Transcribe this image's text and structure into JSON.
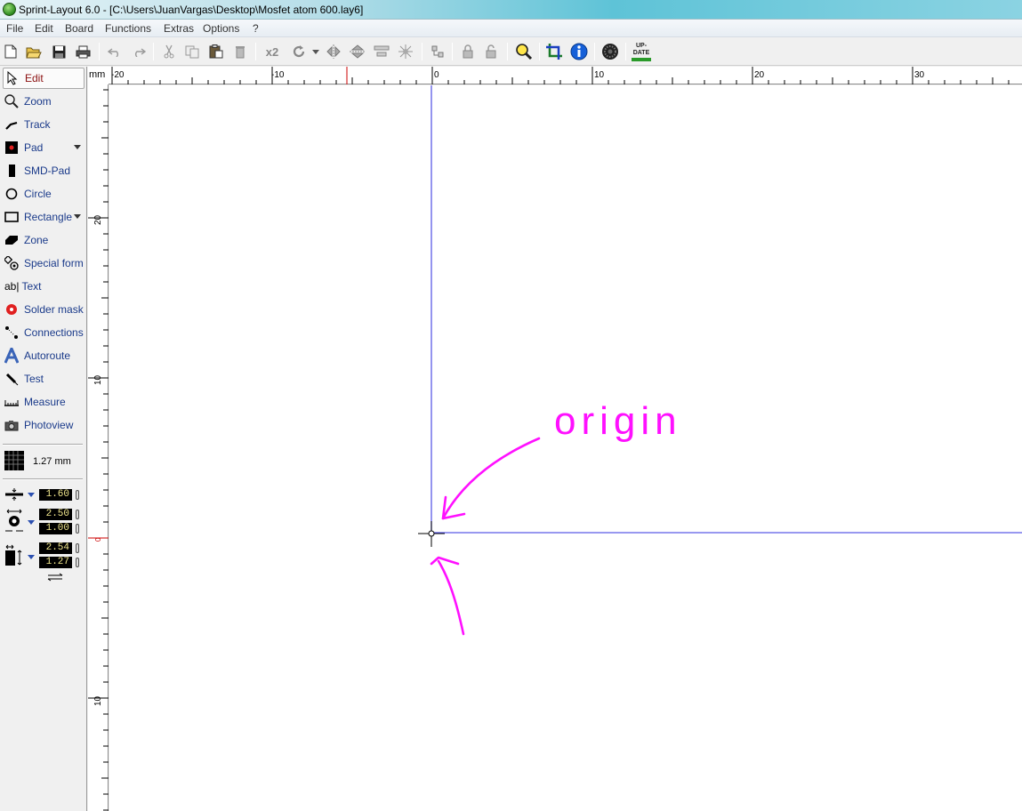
{
  "window": {
    "title": "Sprint-Layout 6.0 - [C:\\Users\\JuanVargas\\Desktop\\Mosfet atom 600.lay6]"
  },
  "menu": [
    "File",
    "Edit",
    "Board",
    "Functions",
    "Extras",
    "Options",
    "?"
  ],
  "toolbar": {
    "icons": [
      "new-file-icon",
      "open-folder-icon",
      "save-icon",
      "print-icon",
      "undo-icon",
      "redo-icon",
      "cut-icon",
      "copy-icon",
      "paste-icon",
      "delete-icon",
      "duplicate-x2-icon",
      "rotate-icon",
      "mirror-horizontal-icon",
      "mirror-vertical-icon",
      "align-icon",
      "group-icon",
      "ungroup-icon",
      "lock-icon",
      "unlock-icon",
      "zoom-icon",
      "crop-icon",
      "info-icon",
      "photoview-icon",
      "update-icon"
    ],
    "x2_label": "x2",
    "update_label_line1": "UP-",
    "update_label_line2": "DATE"
  },
  "tools": [
    {
      "label": "Edit",
      "icon": "arrow-pointer-icon",
      "selected": true
    },
    {
      "label": "Zoom",
      "icon": "magnifier-icon"
    },
    {
      "label": "Track",
      "icon": "track-icon"
    },
    {
      "label": "Pad",
      "icon": "pad-icon",
      "dropdown": true
    },
    {
      "label": "SMD-Pad",
      "icon": "smd-pad-icon"
    },
    {
      "label": "Circle",
      "icon": "circle-icon"
    },
    {
      "label": "Rectangle",
      "icon": "rectangle-icon",
      "dropdown": true
    },
    {
      "label": "Zone",
      "icon": "zone-icon"
    },
    {
      "label": "Special form",
      "icon": "special-form-icon"
    },
    {
      "label": "Text",
      "icon": "text-icon"
    },
    {
      "label": "Solder mask",
      "icon": "solder-mask-icon"
    },
    {
      "label": "Connections",
      "icon": "connections-icon"
    },
    {
      "label": "Autoroute",
      "icon": "autoroute-icon"
    },
    {
      "label": "Test",
      "icon": "test-probe-icon"
    },
    {
      "label": "Measure",
      "icon": "measure-icon"
    },
    {
      "label": "Photoview",
      "icon": "camera-icon"
    }
  ],
  "text_icon_glyph": "ab|",
  "grid": {
    "value": "1.27 mm"
  },
  "params": {
    "track_width": "1.60",
    "pad_outer": "2.50",
    "pad_inner": "1.00",
    "smd_width": "2.54",
    "smd_height": "1.27"
  },
  "ruler": {
    "unit": "mm",
    "top_labels": [
      "-20",
      "-10",
      "0",
      "10",
      "20",
      "30"
    ],
    "left_labels": [
      "20",
      "10",
      "0",
      "10"
    ]
  },
  "annotation": {
    "text": "origin",
    "color": "#ff00ff"
  },
  "colors": {
    "origin_axes": "#5a5ae6",
    "cursor_marker": "#cc0000"
  }
}
